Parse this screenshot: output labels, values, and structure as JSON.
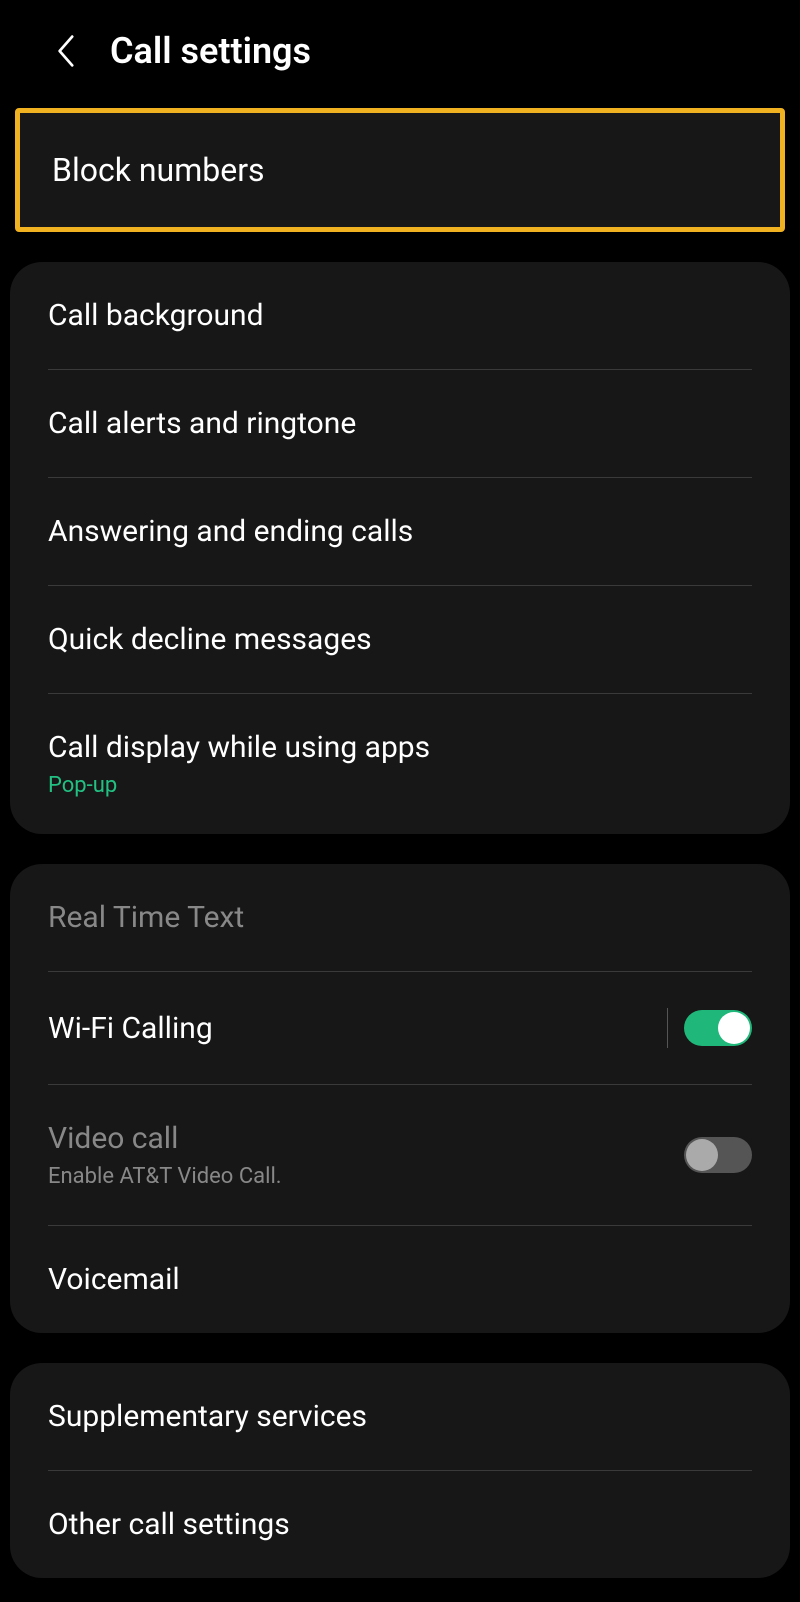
{
  "header": {
    "title": "Call settings"
  },
  "highlighted": {
    "label": "Block numbers"
  },
  "card1": {
    "items": [
      {
        "label": "Call background"
      },
      {
        "label": "Call alerts and ringtone"
      },
      {
        "label": "Answering and ending calls"
      },
      {
        "label": "Quick decline messages"
      },
      {
        "label": "Call display while using apps",
        "sublabel": "Pop-up"
      }
    ]
  },
  "card2": {
    "section_header": "Real Time Text",
    "wifi_calling": {
      "label": "Wi-Fi Calling",
      "toggle": true
    },
    "video_call": {
      "label": "Video call",
      "description": "Enable AT&T Video Call.",
      "toggle": false
    },
    "voicemail": {
      "label": "Voicemail"
    }
  },
  "card3": {
    "items": [
      {
        "label": "Supplementary services"
      },
      {
        "label": "Other call settings"
      }
    ]
  }
}
